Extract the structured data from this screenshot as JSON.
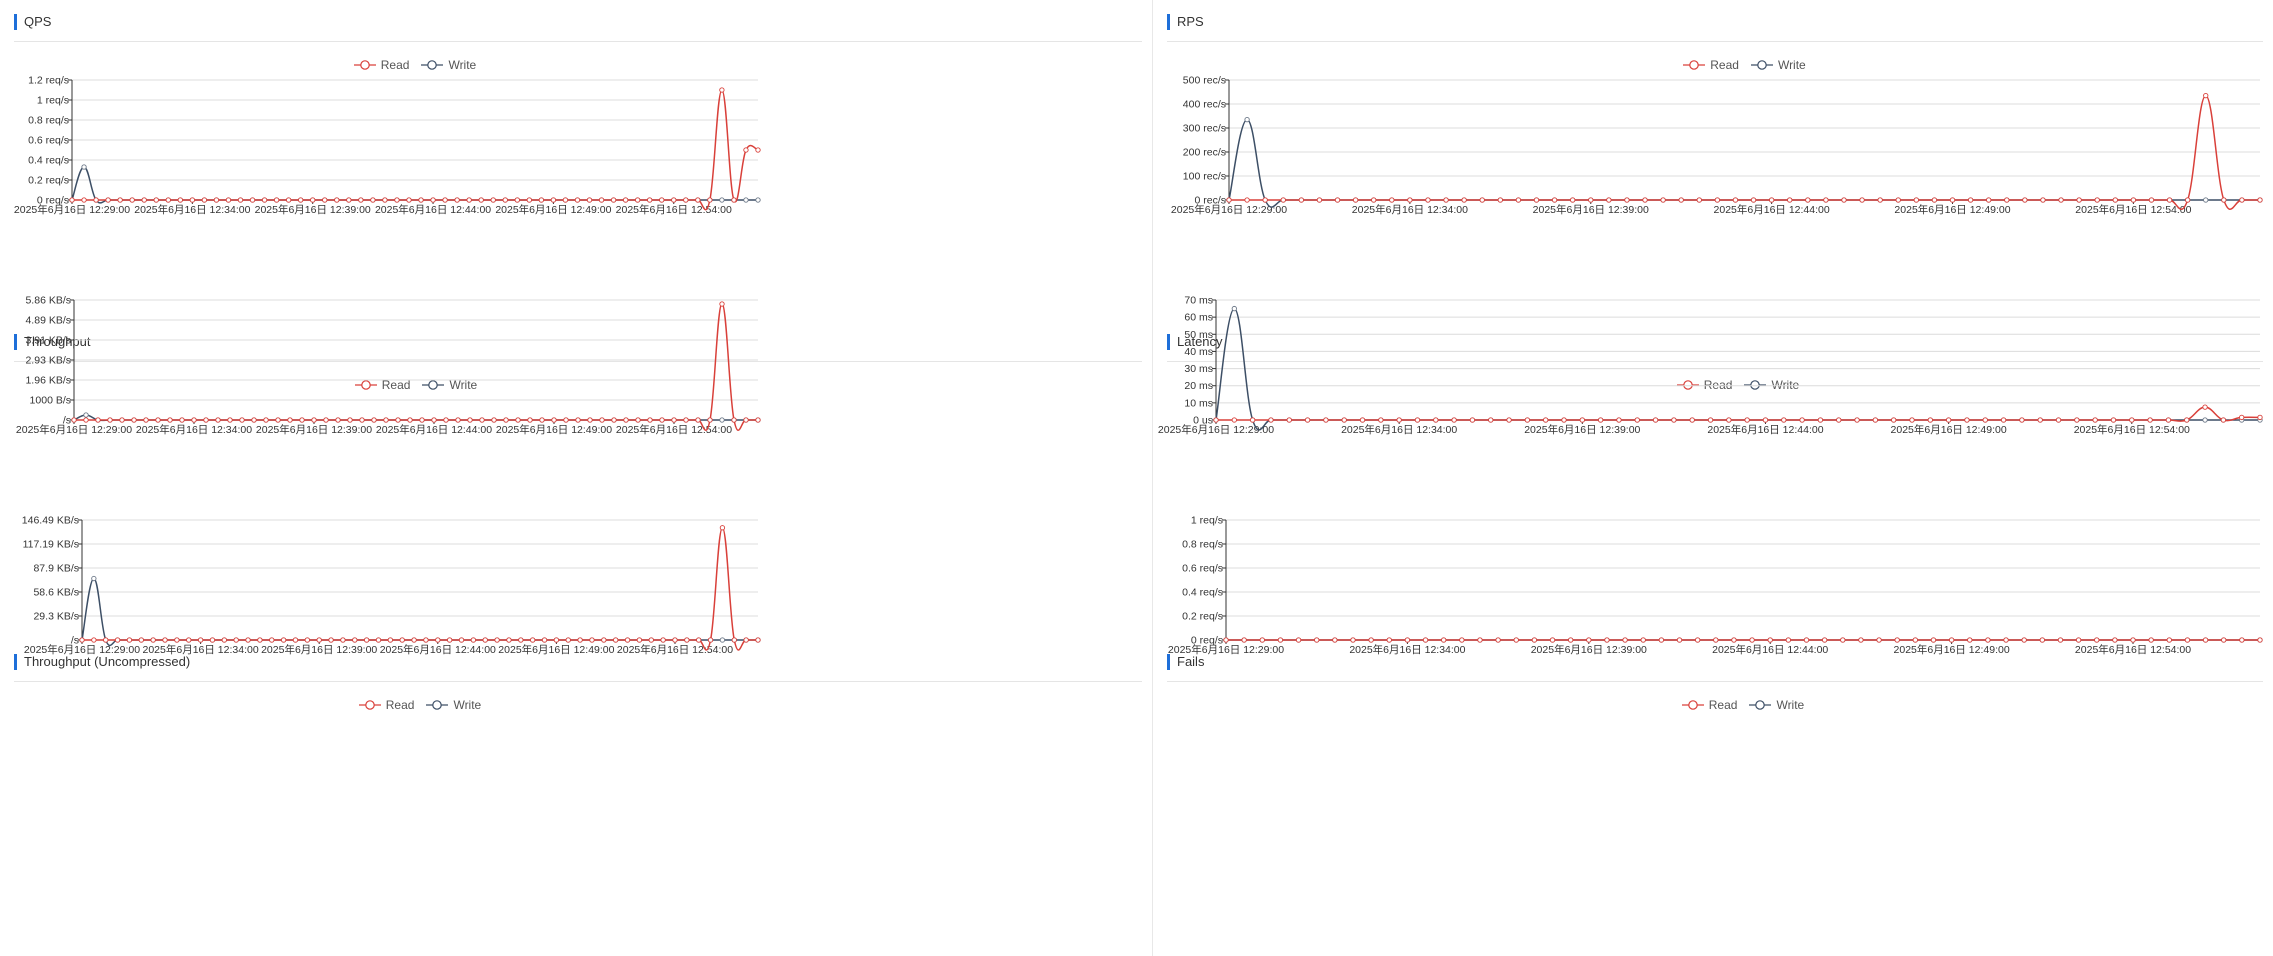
{
  "legend": {
    "read": "Read",
    "write": "Write"
  },
  "colors": {
    "read": "#d9403a",
    "write": "#3d4f66",
    "grid": "#dcdcdc",
    "axis": "#333333",
    "accent": "#1e6fd9"
  },
  "chart_data": [
    {
      "title": "QPS",
      "type": "line",
      "unit": "req/s",
      "y_ticks": [
        "0 req/s",
        "0.2 req/s",
        "0.4 req/s",
        "0.6 req/s",
        "0.8 req/s",
        "1 req/s",
        "1.2 req/s"
      ],
      "ylim": [
        0,
        1.2
      ],
      "x_ticks": [
        "2025年6月16日 12:29:00",
        "2025年6月16日 12:34:00",
        "2025年6月16日 12:39:00",
        "2025年6月16日 12:44:00",
        "2025年6月16日 12:49:00",
        "2025年6月16日 12:54:00"
      ],
      "x_start": "2025-06-16 12:29:00",
      "x_end": "2025-06-16 12:57:30",
      "sample_interval_s": 30,
      "series": [
        {
          "name": "Read",
          "peaks": [
            {
              "t": "12:56:00",
              "v": 1.1
            },
            {
              "t": "12:57:00",
              "v": 0.5
            }
          ],
          "end_value": 0.5
        },
        {
          "name": "Write",
          "peaks": [
            {
              "t": "12:29:30",
              "v": 0.33
            }
          ],
          "end_value": 0
        }
      ]
    },
    {
      "title": "RPS",
      "type": "line",
      "unit": "rec/s",
      "y_ticks": [
        "0 rec/s",
        "100 rec/s",
        "200 rec/s",
        "300 rec/s",
        "400 rec/s",
        "500 rec/s"
      ],
      "ylim": [
        0,
        500
      ],
      "x_ticks": [
        "2025年6月16日 12:29:00",
        "2025年6月16日 12:34:00",
        "2025年6月16日 12:39:00",
        "2025年6月16日 12:44:00",
        "2025年6月16日 12:49:00",
        "2025年6月16日 12:54:00"
      ],
      "x_start": "2025-06-16 12:29:00",
      "x_end": "2025-06-16 12:57:30",
      "sample_interval_s": 30,
      "series": [
        {
          "name": "Read",
          "peaks": [
            {
              "t": "12:56:00",
              "v": 435
            }
          ],
          "end_value": 0
        },
        {
          "name": "Write",
          "peaks": [
            {
              "t": "12:29:30",
              "v": 335
            }
          ],
          "end_value": 0
        }
      ]
    },
    {
      "title": "Throughput",
      "type": "line",
      "unit": "B/s",
      "y_ticks": [
        "/s",
        "1000 B/s",
        "1.96 KB/s",
        "2.93 KB/s",
        "3.91 KB/s",
        "4.89 KB/s",
        "5.86 KB/s"
      ],
      "ylim": [
        0,
        6000
      ],
      "x_ticks": [
        "2025年6月16日 12:29:00",
        "2025年6月16日 12:34:00",
        "2025年6月16日 12:39:00",
        "2025年6月16日 12:44:00",
        "2025年6月16日 12:49:00",
        "2025年6月16日 12:54:00"
      ],
      "x_start": "2025-06-16 12:29:00",
      "x_end": "2025-06-16 12:57:30",
      "sample_interval_s": 30,
      "series": [
        {
          "name": "Read",
          "peaks": [
            {
              "t": "12:56:00",
              "v": 5800
            }
          ],
          "end_value": 0
        },
        {
          "name": "Write",
          "peaks": [
            {
              "t": "12:29:30",
              "v": 250
            }
          ],
          "end_value": 0
        }
      ]
    },
    {
      "title": "Latency",
      "type": "line",
      "unit": "ms",
      "y_ticks": [
        "0 us",
        "10 ms",
        "20 ms",
        "30 ms",
        "40 ms",
        "50 ms",
        "60 ms",
        "70 ms"
      ],
      "ylim": [
        0,
        70
      ],
      "x_ticks": [
        "2025年6月16日 12:29:00",
        "2025年6月16日 12:34:00",
        "2025年6月16日 12:39:00",
        "2025年6月16日 12:44:00",
        "2025年6月16日 12:49:00",
        "2025年6月16日 12:54:00"
      ],
      "x_start": "2025-06-16 12:29:00",
      "x_end": "2025-06-16 12:57:30",
      "sample_interval_s": 30,
      "series": [
        {
          "name": "Read",
          "peaks": [
            {
              "t": "12:56:00",
              "v": 7.5
            },
            {
              "t": "12:57:00",
              "v": 1.5
            }
          ],
          "end_value": 1.5
        },
        {
          "name": "Write",
          "peaks": [
            {
              "t": "12:29:30",
              "v": 65
            }
          ],
          "end_value": 0
        }
      ]
    },
    {
      "title": "Throughput (Uncompressed)",
      "type": "line",
      "unit": "KB/s",
      "y_ticks": [
        "/s",
        "29.3 KB/s",
        "58.6 KB/s",
        "87.9 KB/s",
        "117.19 KB/s",
        "146.49 KB/s"
      ],
      "ylim": [
        0,
        146.49
      ],
      "x_ticks": [
        "2025年6月16日 12:29:00",
        "2025年6月16日 12:34:00",
        "2025年6月16日 12:39:00",
        "2025年6月16日 12:44:00",
        "2025年6月16日 12:49:00",
        "2025年6月16日 12:54:00"
      ],
      "x_start": "2025-06-16 12:29:00",
      "x_end": "2025-06-16 12:57:30",
      "sample_interval_s": 30,
      "series": [
        {
          "name": "Read",
          "peaks": [
            {
              "t": "12:56:00",
              "v": 137
            }
          ],
          "end_value": 0
        },
        {
          "name": "Write",
          "peaks": [
            {
              "t": "12:29:30",
              "v": 75
            }
          ],
          "end_value": 0
        }
      ]
    },
    {
      "title": "Fails",
      "type": "line",
      "unit": "req/s",
      "y_ticks": [
        "0 req/s",
        "0.2 req/s",
        "0.4 req/s",
        "0.6 req/s",
        "0.8 req/s",
        "1 req/s"
      ],
      "ylim": [
        0,
        1
      ],
      "x_ticks": [
        "2025年6月16日 12:29:00",
        "2025年6月16日 12:34:00",
        "2025年6月16日 12:39:00",
        "2025年6月16日 12:44:00",
        "2025年6月16日 12:49:00",
        "2025年6月16日 12:54:00"
      ],
      "x_start": "2025-06-16 12:29:00",
      "x_end": "2025-06-16 12:57:30",
      "sample_interval_s": 30,
      "series": [
        {
          "name": "Read",
          "peaks": [],
          "end_value": 0
        },
        {
          "name": "Write",
          "peaks": [],
          "end_value": 0
        }
      ]
    }
  ]
}
